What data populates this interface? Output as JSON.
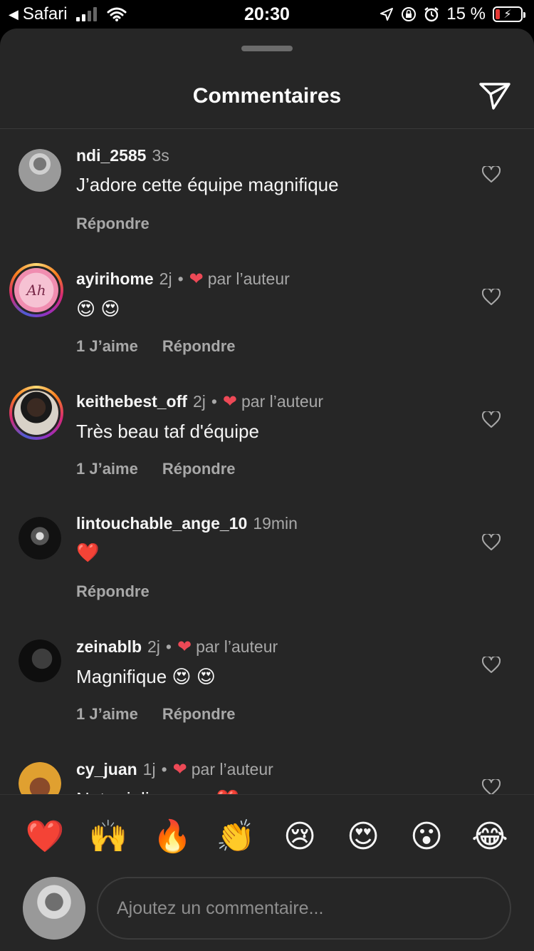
{
  "status_bar": {
    "back_label": "Safari",
    "time": "20:30",
    "battery_text": "15 %"
  },
  "header": {
    "title": "Commentaires"
  },
  "comments": [
    {
      "username": "ndi_2585",
      "time": "3s",
      "liked_by_author": false,
      "by_author_label": "",
      "text": "J’adore cette équipe magnifique",
      "likes_label": "",
      "reply_label": "Répondre"
    },
    {
      "username": "ayirihome",
      "time": "2j",
      "liked_by_author": true,
      "by_author_label": "par l’auteur",
      "text": "😍 😍",
      "likes_label": "1 J’aime",
      "reply_label": "Répondre"
    },
    {
      "username": "keithebest_off",
      "time": "2j",
      "liked_by_author": true,
      "by_author_label": "par l’auteur",
      "text": "Très beau taf d'équipe",
      "likes_label": "1 J’aime",
      "reply_label": "Répondre"
    },
    {
      "username": "lintouchable_ange_10",
      "time": "19min",
      "liked_by_author": false,
      "by_author_label": "",
      "text": "❤️",
      "likes_label": "",
      "reply_label": "Répondre"
    },
    {
      "username": "zeinablb",
      "time": "2j",
      "liked_by_author": true,
      "by_author_label": "par l’auteur",
      "text": "Magnifique 😍 😍",
      "likes_label": "1 J’aime",
      "reply_label": "Répondre"
    },
    {
      "username": "cy_juan",
      "time": "1j",
      "liked_by_author": true,
      "by_author_label": "par l’auteur",
      "text": "Notre jolie coeur ❤️",
      "likes_label": "",
      "reply_label": ""
    }
  ],
  "emoji_bar": [
    "❤️",
    "🙌",
    "🔥",
    "👏",
    "😢",
    "😍",
    "😮",
    "😂"
  ],
  "composer": {
    "placeholder": "Ajoutez un commentaire..."
  },
  "colors": {
    "background": "#262626",
    "author_heart": "#ed4956",
    "muted_text": "#a8a8a8"
  }
}
